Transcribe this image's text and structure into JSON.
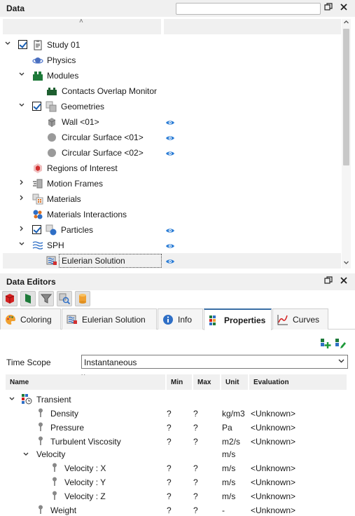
{
  "data_panel": {
    "title": "Data",
    "search_placeholder": "",
    "tree": [
      {
        "label": "Study 01",
        "icon": "study-icon"
      },
      {
        "label": "Physics",
        "icon": "physics-icon"
      },
      {
        "label": "Modules",
        "icon": "modules-icon"
      },
      {
        "label": "Contacts Overlap Monitor",
        "icon": "module-icon"
      },
      {
        "label": "Geometries",
        "icon": "geometries-icon"
      },
      {
        "label": "Wall <01>",
        "icon": "wall-icon"
      },
      {
        "label": "Circular Surface <01>",
        "icon": "circle-surface-icon"
      },
      {
        "label": "Circular Surface <02>",
        "icon": "circle-surface-icon"
      },
      {
        "label": "Regions of Interest",
        "icon": "regions-icon"
      },
      {
        "label": "Motion Frames",
        "icon": "motion-frames-icon"
      },
      {
        "label": "Materials",
        "icon": "materials-icon"
      },
      {
        "label": "Materials Interactions",
        "icon": "materials-interactions-icon"
      },
      {
        "label": "Particles",
        "icon": "particles-icon"
      },
      {
        "label": "SPH",
        "icon": "sph-icon"
      },
      {
        "label": "Eulerian Solution",
        "icon": "eulerian-icon"
      }
    ]
  },
  "editors_panel": {
    "title": "Data Editors",
    "tabs": [
      {
        "label": "Coloring",
        "icon": "palette-icon"
      },
      {
        "label": "Eulerian Solution",
        "icon": "eulerian-icon"
      },
      {
        "label": "Info",
        "icon": "info-icon"
      },
      {
        "label": "Properties",
        "icon": "properties-icon"
      },
      {
        "label": "Curves",
        "icon": "curves-icon"
      }
    ],
    "active_tab": "Properties",
    "time_scope_label": "Time Scope",
    "time_scope_value": "Instantaneous",
    "columns": [
      "Name",
      "Min",
      "Max",
      "Unit",
      "Evaluation"
    ],
    "rows": [
      {
        "name": "Transient",
        "min": "",
        "max": "",
        "unit": "",
        "eval": ""
      },
      {
        "name": "Density",
        "min": "?",
        "max": "?",
        "unit": "kg/m3",
        "eval": "<Unknown>"
      },
      {
        "name": "Pressure",
        "min": "?",
        "max": "?",
        "unit": "Pa",
        "eval": "<Unknown>"
      },
      {
        "name": "Turbulent Viscosity",
        "min": "?",
        "max": "?",
        "unit": "m2/s",
        "eval": "<Unknown>"
      },
      {
        "name": "Velocity",
        "min": "",
        "max": "",
        "unit": "m/s",
        "eval": ""
      },
      {
        "name": "Velocity : X",
        "min": "?",
        "max": "?",
        "unit": "m/s",
        "eval": "<Unknown>"
      },
      {
        "name": "Velocity : Y",
        "min": "?",
        "max": "?",
        "unit": "m/s",
        "eval": "<Unknown>"
      },
      {
        "name": "Velocity : Z",
        "min": "?",
        "max": "?",
        "unit": "m/s",
        "eval": "<Unknown>"
      },
      {
        "name": "Weight",
        "min": "?",
        "max": "?",
        "unit": "-",
        "eval": "<Unknown>"
      }
    ]
  },
  "colors": {
    "accent": "#3a6ea5",
    "eye": "#2f7fd6",
    "modules_green": "#1e7a3a"
  }
}
